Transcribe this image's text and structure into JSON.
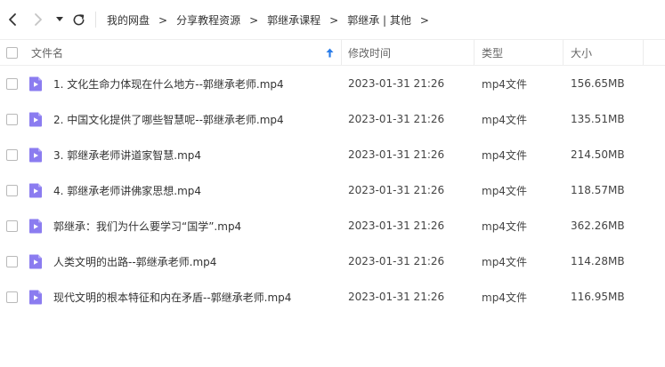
{
  "nav": {
    "back_icon": "chevron-left-icon",
    "forward_icon": "chevron-right-icon",
    "history_icon": "caret-down-icon",
    "refresh_icon": "refresh-icon"
  },
  "breadcrumb": {
    "items": [
      "我的网盘",
      "分享教程资源",
      "郭继承课程",
      "郭继承 | 其他"
    ],
    "separator": ">"
  },
  "columns": {
    "name": "文件名",
    "time": "修改时间",
    "type": "类型",
    "size": "大小",
    "sort_icon": "sort-up-arrow-icon"
  },
  "colors": {
    "accent": "#2b7de9",
    "file_icon": "#8b7cf0",
    "file_icon_fold": "#b7adf7"
  },
  "files": [
    {
      "name": "1. 文化生命力体现在什么地方--郭继承老师.mp4",
      "time": "2023-01-31 21:26",
      "type": "mp4文件",
      "size": "156.65MB"
    },
    {
      "name": "2. 中国文化提供了哪些智慧呢--郭继承老师.mp4",
      "time": "2023-01-31 21:26",
      "type": "mp4文件",
      "size": "135.51MB"
    },
    {
      "name": "3. 郭继承老师讲道家智慧.mp4",
      "time": "2023-01-31 21:26",
      "type": "mp4文件",
      "size": "214.50MB"
    },
    {
      "name": "4. 郭继承老师讲佛家思想.mp4",
      "time": "2023-01-31 21:26",
      "type": "mp4文件",
      "size": "118.57MB"
    },
    {
      "name": "郭继承：我们为什么要学习“国学”.mp4",
      "time": "2023-01-31 21:26",
      "type": "mp4文件",
      "size": "362.26MB"
    },
    {
      "name": "人类文明的出路--郭继承老师.mp4",
      "time": "2023-01-31 21:26",
      "type": "mp4文件",
      "size": "114.28MB"
    },
    {
      "name": "现代文明的根本特征和内在矛盾--郭继承老师.mp4",
      "time": "2023-01-31 21:26",
      "type": "mp4文件",
      "size": "116.95MB"
    }
  ]
}
